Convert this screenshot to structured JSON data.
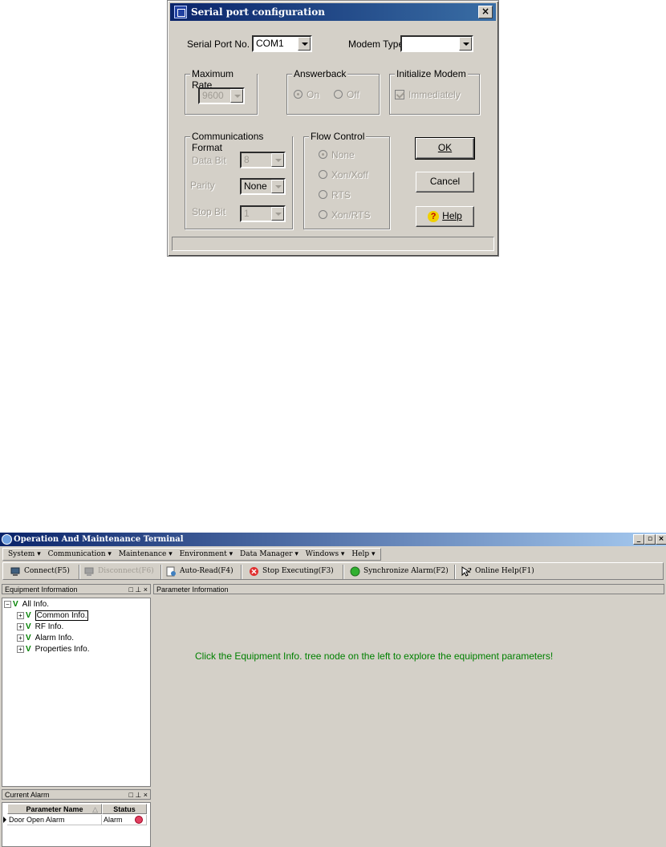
{
  "dialog": {
    "title": "Serial port configuration",
    "close": "×",
    "serial_port_label": "Serial Port No.",
    "serial_port_value": "COM1",
    "modem_type_label": "Modem Type",
    "modem_type_value": "",
    "max_rate": {
      "title": "Maximum Rate",
      "value": "9600"
    },
    "answerback": {
      "title": "Answerback",
      "on": "On",
      "off": "Off",
      "selected": "On"
    },
    "init_modem": {
      "title": "Initialize Modem",
      "immediately": "Immediately",
      "checked": true
    },
    "comm_format": {
      "title": "Communications Format",
      "data_bit_label": "Data Bit",
      "data_bit_value": "8",
      "parity_label": "Parity",
      "parity_value": "None",
      "stop_bit_label": "Stop Bit",
      "stop_bit_value": "1"
    },
    "flow_control": {
      "title": "Flow Control",
      "options": [
        "None",
        "Xon/Xoff",
        "RTS",
        "Xon/RTS"
      ],
      "selected": "None"
    },
    "buttons": {
      "ok": "OK",
      "cancel": "Cancel",
      "help": "Help"
    }
  },
  "app": {
    "title": "Operation And Maintenance Terminal",
    "window_controls": [
      "_",
      "▫",
      "×"
    ],
    "menu": [
      "System ▾",
      "Communication ▾",
      "Maintenance ▾",
      "Environment ▾",
      "Data Manager ▾",
      "Windows ▾",
      "Help ▾"
    ],
    "toolbar": {
      "connect": "Connect(F5)",
      "disconnect": "Disconnect(F6)",
      "auto_read": "Auto-Read(F4)",
      "stop_executing": "Stop Executing(F3)",
      "synchronize_alarm": "Synchronize Alarm(F2)",
      "online_help": "Online Help(F1)"
    },
    "equipment_pane": {
      "title": "Equipment Information",
      "buttons": "□ ⊥ ×",
      "root": "All Info.",
      "children": [
        "Common Info.",
        "RF Info.",
        "Alarm Info.",
        "Properties Info."
      ],
      "selected": "Common Info."
    },
    "parameter_pane": {
      "title": "Parameter Information",
      "message": "Click the Equipment Info. tree node on the left to explore the equipment parameters!"
    },
    "alarm_pane": {
      "title": "Current Alarm",
      "buttons": "□ ⊥ ×",
      "columns": [
        "Parameter Name",
        "Status"
      ],
      "sort_indicator": "△",
      "rows": [
        {
          "name": "Door Open Alarm",
          "status": "Alarm"
        }
      ]
    }
  },
  "colors": {
    "title_bar": "#0a246a",
    "message_green": "#008000",
    "alarm_red": "#e04060",
    "face": "#d4d0c8"
  }
}
